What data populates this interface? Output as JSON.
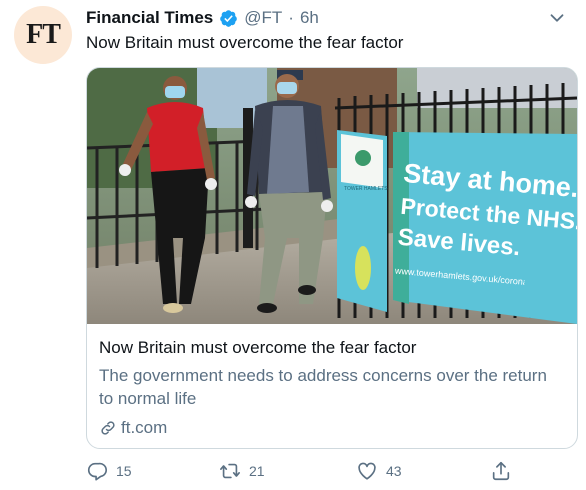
{
  "tweet": {
    "avatar_text": "FT",
    "author_name": "Financial Times",
    "handle": "@FT",
    "separator": "·",
    "time": "6h",
    "text": "Now Britain must overcome the fear factor"
  },
  "card": {
    "title": "Now Britain must overcome the fear factor",
    "description": "The government needs to address concerns over the return to normal life",
    "domain": "ft.com",
    "banner_lines": [
      "Stay at home.",
      "Protect the NHS.",
      "Save lives."
    ],
    "banner_url": "www.towerhamlets.gov.uk/coronav",
    "banner_logo_text": "TOWER HAMLETS"
  },
  "actions": {
    "reply_count": "15",
    "retweet_count": "21",
    "like_count": "43"
  },
  "colors": {
    "verified": "#1da1f2",
    "muted": "#5b7083",
    "avatar_bg": "#fce8d6",
    "banner": "#5cc3d8"
  },
  "icons": [
    "verified-badge-icon",
    "chevron-down-icon",
    "link-icon",
    "reply-icon",
    "retweet-icon",
    "like-icon",
    "share-icon"
  ]
}
